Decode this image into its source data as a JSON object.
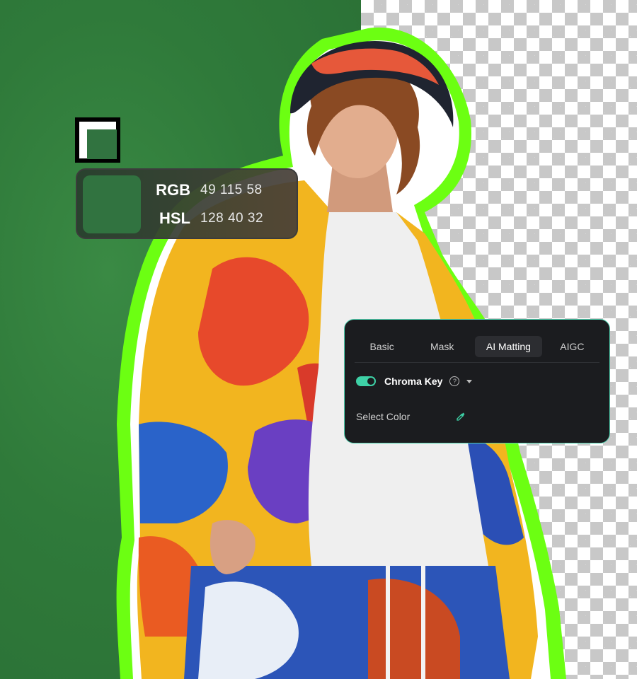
{
  "color_readout": {
    "swatch_color": "#317340",
    "rgb_label": "RGB",
    "rgb_values": "49 115 58",
    "hsl_label": "HSL",
    "hsl_values": "128 40 32"
  },
  "panel": {
    "tabs": [
      {
        "label": "Basic"
      },
      {
        "label": "Mask"
      },
      {
        "label": "AI Matting",
        "active": true
      },
      {
        "label": "AIGC"
      }
    ],
    "chroma_key": {
      "label": "Chroma Key",
      "enabled": true,
      "help_icon": "question-circle-icon",
      "caret_icon": "caret-down-icon"
    },
    "select_color": {
      "label": "Select Color",
      "icon": "eyedropper-icon"
    },
    "accent_color": "#3ed1a6"
  },
  "canvas": {
    "key_color": "#317340",
    "outline_color": "#6cff12",
    "transparency_pattern": "checkerboard"
  }
}
